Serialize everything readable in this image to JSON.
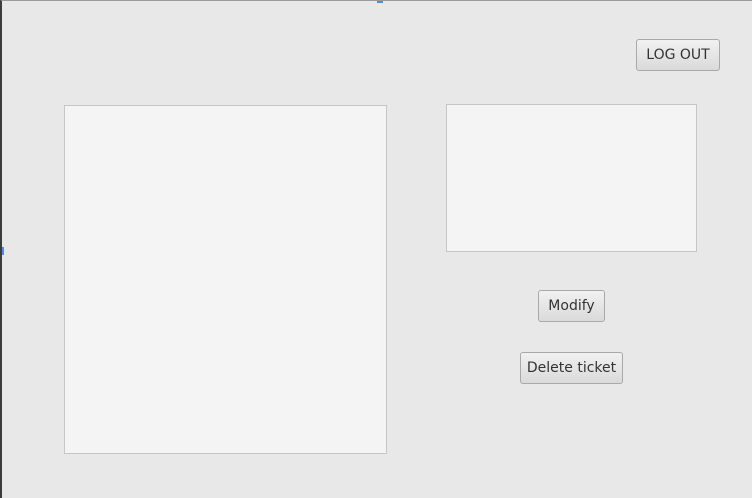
{
  "header": {
    "logout_label": "LOG OUT"
  },
  "actions": {
    "modify_label": "Modify",
    "delete_label": "Delete ticket"
  },
  "ticket_list": {
    "items": []
  },
  "ticket_detail": {
    "text": ""
  }
}
